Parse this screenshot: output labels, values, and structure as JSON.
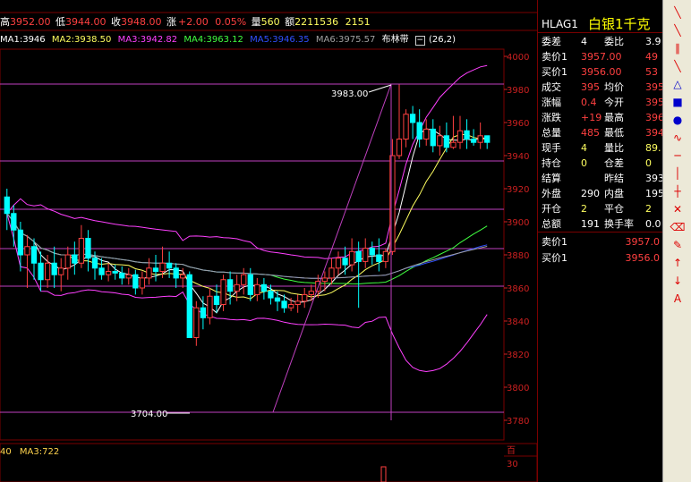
{
  "quote_bar": {
    "high_label": "高",
    "high_value": "3952.00",
    "low_label": "低",
    "low_value": "3944.00",
    "close_label": "收",
    "close_value": "3948.00",
    "change_label": "涨",
    "change_value": "+2.00",
    "change_pct": "0.05%",
    "volume_label": "量",
    "volume_value": "560",
    "amount_label": "额",
    "amount_value": "2211536",
    "extra_value": "2151"
  },
  "ma_bar": {
    "ma1": "MA1:3946",
    "ma2": "MA2:3938.50",
    "ma3": "MA3:3942.82",
    "ma4": "MA4:3963.12",
    "ma5": "MA5:3946.35",
    "ma6": "MA6:3975.57",
    "indicator_name": "布林带",
    "indicator_params": "(26,2)"
  },
  "sub_indicator": {
    "left_text": "40",
    "ma3_text": "MA3:722"
  },
  "chart_data": {
    "type": "candlestick",
    "ylim": [
      3780,
      4000
    ],
    "y_ticks": [
      "4000",
      "3980",
      "3960",
      "3940",
      "3920",
      "3900",
      "3880",
      "3860",
      "3840",
      "3820",
      "3800",
      "3780"
    ],
    "annotations": {
      "high_marker": "3983.00",
      "low_marker": "3704.00"
    },
    "candles": [
      [
        3915,
        3905,
        3920,
        3895
      ],
      [
        3905,
        3895,
        3910,
        3885
      ],
      [
        3895,
        3880,
        3900,
        3870
      ],
      [
        3880,
        3885,
        3892,
        3860
      ],
      [
        3885,
        3875,
        3890,
        3865
      ],
      [
        3875,
        3865,
        3882,
        3858
      ],
      [
        3865,
        3875,
        3880,
        3860
      ],
      [
        3875,
        3868,
        3885,
        3860
      ],
      [
        3868,
        3872,
        3878,
        3858
      ],
      [
        3872,
        3880,
        3885,
        3865
      ],
      [
        3880,
        3875,
        3888,
        3868
      ],
      [
        3875,
        3890,
        3898,
        3872
      ],
      [
        3890,
        3878,
        3895,
        3870
      ],
      [
        3878,
        3872,
        3882,
        3865
      ],
      [
        3872,
        3868,
        3878,
        3865
      ],
      [
        3868,
        3870,
        3875,
        3864
      ],
      [
        3870,
        3869,
        3874,
        3865
      ],
      [
        3869,
        3866,
        3873,
        3862
      ],
      [
        3866,
        3868,
        3872,
        3862
      ],
      [
        3868,
        3860,
        3871,
        3856
      ],
      [
        3860,
        3866,
        3870,
        3856
      ],
      [
        3866,
        3872,
        3878,
        3862
      ],
      [
        3872,
        3870,
        3880,
        3864
      ],
      [
        3870,
        3875,
        3885,
        3866
      ],
      [
        3875,
        3872,
        3882,
        3866
      ],
      [
        3872,
        3866,
        3875,
        3860
      ],
      [
        3866,
        3868,
        3872,
        3860
      ],
      [
        3868,
        3830,
        3870,
        3830
      ],
      [
        3830,
        3848,
        3852,
        3825
      ],
      [
        3848,
        3842,
        3855,
        3835
      ],
      [
        3842,
        3855,
        3860,
        3838
      ],
      [
        3855,
        3850,
        3862,
        3845
      ],
      [
        3850,
        3865,
        3868,
        3846
      ],
      [
        3865,
        3858,
        3870,
        3850
      ],
      [
        3858,
        3862,
        3868,
        3852
      ],
      [
        3862,
        3868,
        3872,
        3856
      ],
      [
        3868,
        3856,
        3872,
        3852
      ],
      [
        3856,
        3862,
        3866,
        3852
      ],
      [
        3862,
        3858,
        3866,
        3853
      ],
      [
        3858,
        3854,
        3862,
        3850
      ],
      [
        3854,
        3852,
        3858,
        3846
      ],
      [
        3852,
        3848,
        3856,
        3845
      ],
      [
        3848,
        3850,
        3854,
        3846
      ],
      [
        3850,
        3852,
        3856,
        3845
      ],
      [
        3852,
        3856,
        3860,
        3848
      ],
      [
        3856,
        3858,
        3862,
        3852
      ],
      [
        3858,
        3864,
        3868,
        3854
      ],
      [
        3864,
        3866,
        3870,
        3858
      ],
      [
        3866,
        3872,
        3878,
        3862
      ],
      [
        3872,
        3878,
        3882,
        3868
      ],
      [
        3878,
        3874,
        3885,
        3868
      ],
      [
        3874,
        3882,
        3890,
        3870
      ],
      [
        3882,
        3876,
        3888,
        3848
      ],
      [
        3876,
        3884,
        3890,
        3872
      ],
      [
        3884,
        3880,
        3888,
        3874
      ],
      [
        3880,
        3876,
        3890,
        3870
      ],
      [
        3876,
        3882,
        3884,
        3872
      ],
      [
        3882,
        3940,
        3950,
        3880
      ],
      [
        3940,
        3950,
        3983,
        3938
      ],
      [
        3950,
        3965,
        3968,
        3945
      ],
      [
        3965,
        3960,
        3970,
        3950
      ],
      [
        3960,
        3950,
        3968,
        3945
      ],
      [
        3950,
        3956,
        3962,
        3946
      ],
      [
        3956,
        3946,
        3962,
        3942
      ],
      [
        3946,
        3952,
        3958,
        3940
      ],
      [
        3952,
        3945,
        3960,
        3942
      ],
      [
        3945,
        3948,
        3964,
        3944
      ],
      [
        3948,
        3955,
        3964,
        3944
      ],
      [
        3955,
        3950,
        3962,
        3944
      ],
      [
        3950,
        3948,
        3956,
        3946
      ],
      [
        3948,
        3952,
        3960,
        3944
      ],
      [
        3952,
        3948,
        3952,
        3944
      ]
    ]
  },
  "right_panel": {
    "code": "HLAG1",
    "name": "白银1千克",
    "rows": [
      {
        "l1": "委差",
        "v1": "4",
        "l2": "委比",
        "v2": "3.9"
      },
      {
        "l1": "卖价1",
        "v1": "3957.00",
        "l2": "",
        "v2": "49"
      },
      {
        "l1": "买价1",
        "v1": "3956.00",
        "l2": "",
        "v2": "53"
      },
      {
        "l1": "成交",
        "v1": "395",
        "l2": "均价",
        "v2": "395"
      },
      {
        "l1": "涨幅",
        "v1": "0.4",
        "l2": "今开",
        "v2": "395"
      },
      {
        "l1": "涨跌",
        "v1": "+19",
        "l2": "最高",
        "v2": "396"
      },
      {
        "l1": "总量",
        "v1": "485",
        "l2": "最低",
        "v2": "394"
      },
      {
        "l1": "现手",
        "v1": "4",
        "l2": "量比",
        "v2": "89."
      },
      {
        "l1": "持仓",
        "v1": "0",
        "l2": "仓差",
        "v2": "0"
      },
      {
        "l1": "结算",
        "v1": "",
        "l2": "昨结",
        "v2": "393"
      },
      {
        "l1": "外盘",
        "v1": "290",
        "l2": "内盘",
        "v2": "195"
      },
      {
        "l1": "开仓",
        "v1": "2",
        "l2": "平仓",
        "v2": "2"
      },
      {
        "l1": "总额",
        "v1": "191",
        "l2": "换手率",
        "v2": "0.0"
      }
    ],
    "sell1_label": "卖价1",
    "sell1_value": "3957.0",
    "buy1_label": "买价1",
    "buy1_value": "3956.0"
  },
  "colors": {
    "up": "#ff4040",
    "down": "#00ffff",
    "ma1": "#ffffff",
    "ma2": "#ffff60",
    "ma3": "#ff40ff",
    "ma4": "#40ff40",
    "ma5": "#3050ff",
    "ma6": "#a0a0a0"
  },
  "toolbar_icons": [
    "line-tool-icon",
    "ray-tool-icon",
    "parallel-tool-icon",
    "segment-tool-icon",
    "triangle-tool-icon",
    "rect-tool-icon",
    "circle-tool-icon",
    "curve-tool-icon",
    "hline-tool-icon",
    "vline-tool-icon",
    "grid-tool-icon",
    "cross-tool-icon",
    "eraser-tool-icon",
    "pencil-tool-icon",
    "arrow-up-icon",
    "arrow-down-icon",
    "text-tool-icon"
  ]
}
